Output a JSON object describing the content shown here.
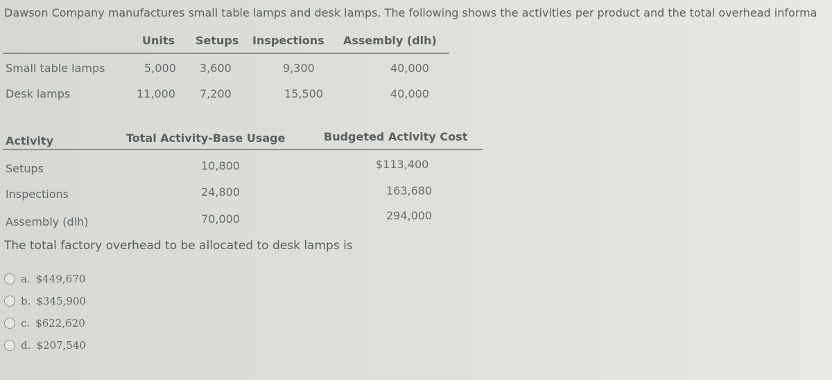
{
  "intro": "Dawson Company manufactures small table lamps and desk lamps. The following shows the activities per product and the total overhead informa",
  "product_table": {
    "headers": [
      "Units",
      "Setups",
      "Inspections",
      "Assembly (dlh)"
    ],
    "rows": [
      {
        "label": "Small table lamps",
        "units": "5,000",
        "setups": "3,600",
        "inspections": "9,300",
        "assembly": "40,000"
      },
      {
        "label": "Desk lamps",
        "units": "11,000",
        "setups": "7,200",
        "inspections": "15,500",
        "assembly": "40,000"
      }
    ]
  },
  "activity_table": {
    "headers": [
      "Activity",
      "Total Activity-Base Usage",
      "Budgeted Activity Cost"
    ],
    "rows": [
      {
        "activity": "Setups",
        "usage": "10,800",
        "cost": "$113,400"
      },
      {
        "activity": "Inspections",
        "usage": "24,800",
        "cost": "163,680"
      },
      {
        "activity": "Assembly (dlh)",
        "usage": "70,000",
        "cost": "294,000"
      }
    ]
  },
  "question": "The total factory overhead to be allocated to desk lamps is",
  "options": [
    {
      "letter": "a.",
      "value": "$449,670"
    },
    {
      "letter": "b.",
      "value": "$345,900"
    },
    {
      "letter": "c.",
      "value": "$622,620"
    },
    {
      "letter": "d.",
      "value": "$207,540"
    }
  ]
}
